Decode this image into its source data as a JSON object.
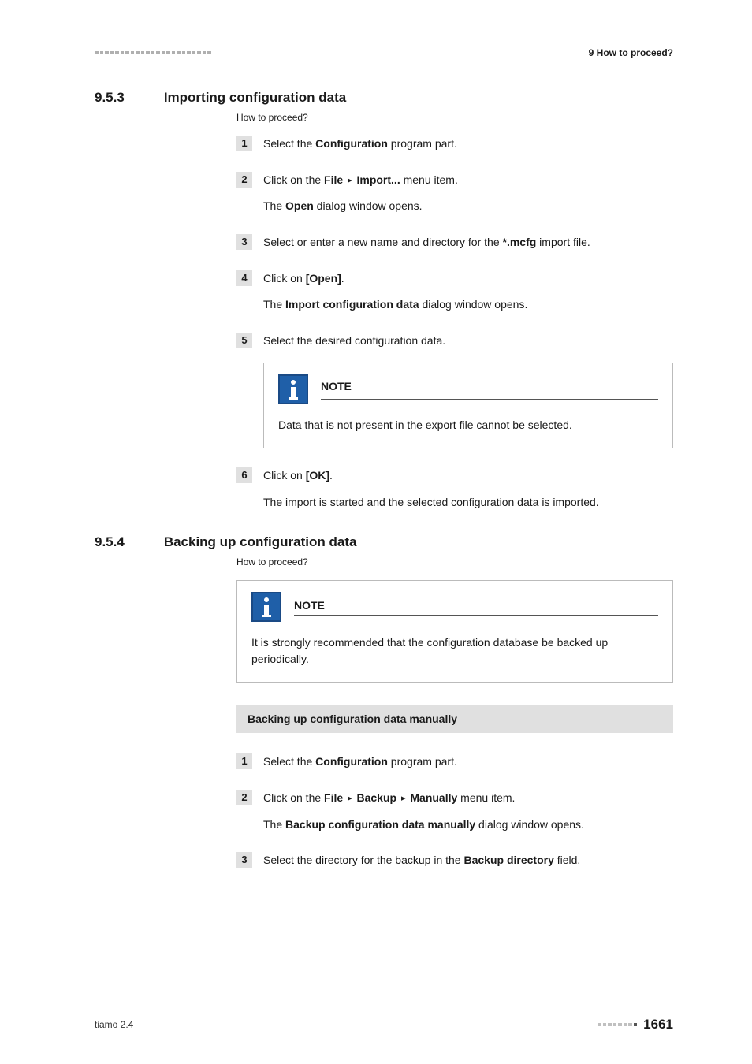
{
  "header": {
    "chapter": "9 How to proceed?"
  },
  "sections": [
    {
      "number": "9.5.3",
      "title": "Importing configuration data",
      "subcaption": "How to proceed?",
      "steps": [
        {
          "n": "1",
          "parts": [
            "Select the ",
            {
              "b": "Configuration"
            },
            " program part."
          ]
        },
        {
          "n": "2",
          "parts": [
            "Click on the ",
            {
              "b": "File"
            },
            " ",
            {
              "a": "▸"
            },
            " ",
            {
              "b": "Import..."
            },
            " menu item."
          ],
          "sub": [
            "The ",
            {
              "b": "Open"
            },
            " dialog window opens."
          ]
        },
        {
          "n": "3",
          "parts": [
            "Select or enter a new name and directory for the ",
            {
              "b": "*.mcfg"
            },
            " import file."
          ]
        },
        {
          "n": "4",
          "parts": [
            "Click on ",
            {
              "b": "[Open]"
            },
            "."
          ],
          "sub": [
            "The ",
            {
              "b": "Import configuration data"
            },
            " dialog window opens."
          ]
        },
        {
          "n": "5",
          "parts": [
            "Select the desired configuration data."
          ],
          "note": {
            "title": "NOTE",
            "body": "Data that is not present in the export file cannot be selected."
          }
        },
        {
          "n": "6",
          "parts": [
            "Click on ",
            {
              "b": "[OK]"
            },
            "."
          ],
          "sub": [
            "The import is started and the selected configuration data is imported."
          ]
        }
      ]
    },
    {
      "number": "9.5.4",
      "title": "Backing up configuration data",
      "subcaption": "How to proceed?",
      "topnote": {
        "title": "NOTE",
        "body": "It is strongly recommended that the configuration database be backed up periodically."
      },
      "subsection_bar": "Backing up configuration data manually",
      "steps": [
        {
          "n": "1",
          "parts": [
            "Select the ",
            {
              "b": "Configuration"
            },
            " program part."
          ]
        },
        {
          "n": "2",
          "parts": [
            "Click on the ",
            {
              "b": "File"
            },
            " ",
            {
              "a": "▸"
            },
            " ",
            {
              "b": "Backup"
            },
            " ",
            {
              "a": "▸"
            },
            " ",
            {
              "b": "Manually"
            },
            " menu item."
          ],
          "sub": [
            "The ",
            {
              "b": "Backup configuration data manually"
            },
            " dialog window opens."
          ]
        },
        {
          "n": "3",
          "parts": [
            "Select the directory for the backup in the ",
            {
              "b": "Backup directory"
            },
            " field."
          ]
        }
      ]
    }
  ],
  "footer": {
    "left": "tiamo 2.4",
    "page": "1661"
  }
}
